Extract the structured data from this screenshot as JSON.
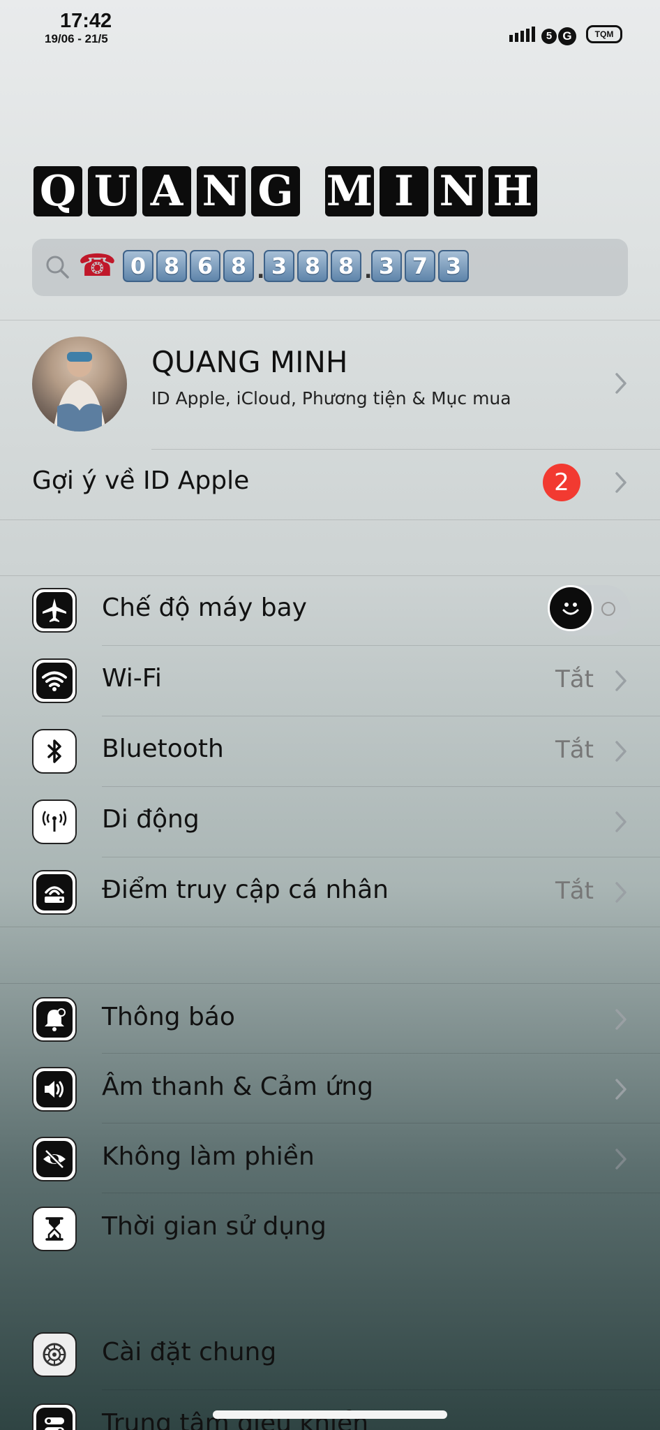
{
  "status_bar": {
    "time": "17:42",
    "date": "19/06 - 21/5",
    "network": "5G",
    "battery_label": "TQM"
  },
  "header": {
    "title_words": [
      [
        "Q",
        "U",
        "A",
        "N",
        "G"
      ],
      [
        "M",
        "I",
        "N",
        "H"
      ]
    ],
    "search": {
      "phone_digits_groups": [
        [
          "0",
          "8",
          "6",
          "8"
        ],
        [
          "3",
          "8",
          "8"
        ],
        [
          "3",
          "7",
          "3"
        ]
      ]
    }
  },
  "profile": {
    "name": "QUANG MINH",
    "subtitle": "ID Apple, iCloud, Phương tiện & Mục mua"
  },
  "suggestion": {
    "label": "Gợi ý về ID Apple",
    "badge": "2"
  },
  "group1": [
    {
      "label": "Chế độ máy bay",
      "icon": "airplane-icon",
      "toggle_on": false
    },
    {
      "label": "Wi-Fi",
      "icon": "wifi-icon",
      "value": "Tắt"
    },
    {
      "label": "Bluetooth",
      "icon": "bluetooth-icon",
      "value": "Tắt"
    },
    {
      "label": "Di động",
      "icon": "cellular-antenna-icon"
    },
    {
      "label": "Điểm truy cập cá nhân",
      "icon": "hotspot-icon",
      "value": "Tắt"
    }
  ],
  "group2": [
    {
      "label": "Thông báo",
      "icon": "bell-icon"
    },
    {
      "label": "Âm thanh & Cảm ứng",
      "icon": "speaker-icon"
    },
    {
      "label": "Không làm phiền",
      "icon": "eye-slash-icon"
    },
    {
      "label": "Thời gian sử dụng",
      "icon": "hourglass-icon"
    }
  ],
  "group3": [
    {
      "label": "Cài đặt chung",
      "icon": "gear-icon"
    },
    {
      "label": "Trung tâm điều khiển",
      "icon": "control-center-icon"
    }
  ],
  "colors": {
    "badge": "#f23a31",
    "keycap": "#6f93b8",
    "phone_icon": "#c0182a"
  }
}
